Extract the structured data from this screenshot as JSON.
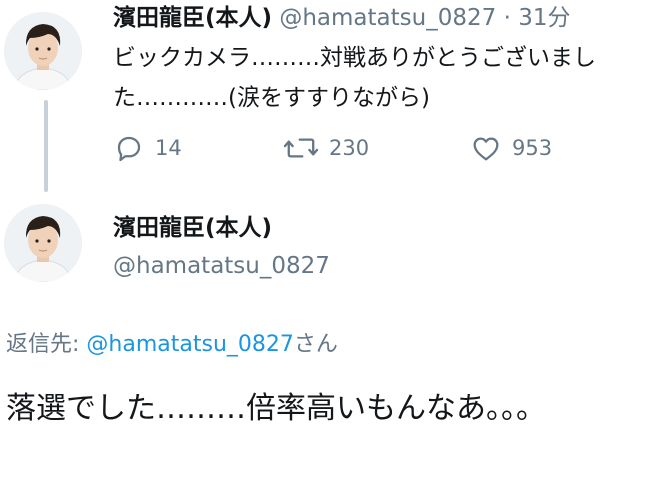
{
  "parent_tweet": {
    "display_name": "濱田龍臣(本人)",
    "handle": "@hamatatsu_0827",
    "separator": "·",
    "time": "31分",
    "text": "ビックカメラ………対戦ありがとうございました…………(涙をすすりながら)",
    "actions": {
      "reply_icon": "reply-icon",
      "reply_count": "14",
      "retweet_icon": "retweet-icon",
      "retweet_count": "230",
      "like_icon": "heart-icon",
      "like_count": "953"
    }
  },
  "main_tweet": {
    "display_name": "濱田龍臣(本人)",
    "handle": "@hamatatsu_0827",
    "reply_to_label": "返信先:",
    "reply_to_handle": "@hamatatsu_0827",
    "reply_to_suffix": "さん",
    "text": "落選でした………倍率高いもんなあ。。。"
  },
  "colors": {
    "text": "#14171a",
    "secondary": "#657786",
    "link": "#1b95e0",
    "thread_line": "#c9d1d8"
  }
}
